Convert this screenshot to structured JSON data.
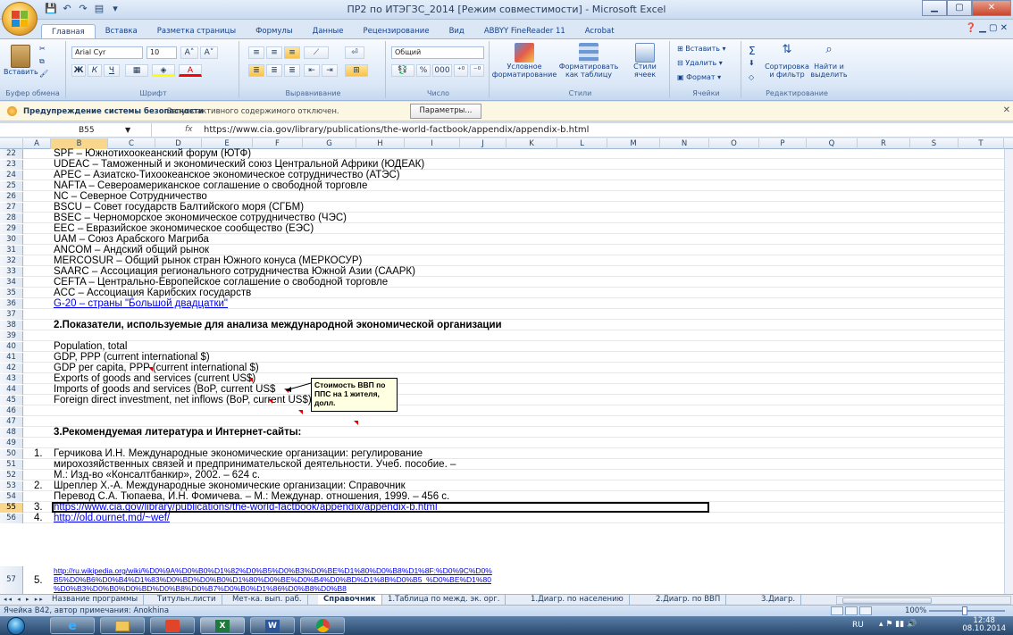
{
  "window": {
    "title": "ПР2 по ИТЭГЗС_2014  [Режим совместимости] - Microsoft Excel",
    "minimize": "▁",
    "maximize": "▢",
    "close": "✕"
  },
  "ribbon_tabs": [
    "Главная",
    "Вставка",
    "Разметка страницы",
    "Формулы",
    "Данные",
    "Рецензирование",
    "Вид",
    "ABBYY FineReader 11",
    "Acrobat"
  ],
  "ribbon": {
    "clipboard": {
      "paste": "Вставить",
      "label": "Буфер обмена"
    },
    "font": {
      "name": "Arial Cyr",
      "size": "10",
      "label": "Шрифт",
      "bold": "Ж",
      "italic": "К",
      "underline": "Ч",
      "grow": "A˄",
      "shrink": "A˅"
    },
    "alignment": {
      "label": "Выравнивание"
    },
    "number": {
      "format": "Общий",
      "label": "Число",
      "percent": "%",
      "thousands": "000"
    },
    "styles": {
      "conditional": "Условное форматирование",
      "as_table": "Форматировать как таблицу",
      "cell_styles": "Стили ячеек",
      "label": "Стили"
    },
    "cells": {
      "insert": "Вставить",
      "delete": "Удалить",
      "format": "Формат",
      "label": "Ячейки"
    },
    "editing": {
      "sum": "Σ",
      "sort": "Сортировка и фильтр",
      "find": "Найти и выделить",
      "label": "Редактирование"
    }
  },
  "security_bar": {
    "title": "Предупреждение системы безопасности",
    "message": "Запуск активного содержимого отключен.",
    "button": "Параметры..."
  },
  "formula_bar": {
    "name_box": "B55",
    "fx": "fx",
    "content": "https://www.cia.gov/library/publications/the-world-factbook/appendix/appendix-b.html"
  },
  "columns": [
    "A",
    "B",
    "C",
    "D",
    "E",
    "F",
    "G",
    "H",
    "I",
    "J",
    "K",
    "L",
    "M",
    "N",
    "O",
    "P",
    "Q",
    "R",
    "S",
    "T"
  ],
  "rows": [
    {
      "n": "22",
      "a": "",
      "b": "SPF – Южнотихоокеанский форум (ЮТФ)"
    },
    {
      "n": "23",
      "a": "",
      "b": "UDEAC – Таможенный и экономический союз Центральной Африки (ЮДЕАК)"
    },
    {
      "n": "24",
      "a": "",
      "b": "APEC – Азиатско-Тихоокеанское экономическое сотрудничество (АТЭС)"
    },
    {
      "n": "25",
      "a": "",
      "b": "NAFTA – Североамериканское соглашение о свободной торговле"
    },
    {
      "n": "26",
      "a": "",
      "b": "NC – Северное Сотрудничество"
    },
    {
      "n": "27",
      "a": "",
      "b": "BSCU – Совет государств Балтийского моря (СГБМ)"
    },
    {
      "n": "28",
      "a": "",
      "b": "BSEC – Черноморское экономическое сотрудничество (ЧЭС)"
    },
    {
      "n": "29",
      "a": "",
      "b": "EEC – Евразийское экономическое сообщество (ЕЭС)"
    },
    {
      "n": "30",
      "a": "",
      "b": "UAM – Союз Арабского Магриба"
    },
    {
      "n": "31",
      "a": "",
      "b": "ANCOM – Андский общий рынок"
    },
    {
      "n": "32",
      "a": "",
      "b": "MERCOSUR – Общий рынок стран Южного конуса (МЕРКОСУР)"
    },
    {
      "n": "33",
      "a": "",
      "b": "SAARC – Ассоциация регионального сотрудничества Южной Азии (СААРК)"
    },
    {
      "n": "34",
      "a": "",
      "b": "CEFTA – Центрально-Европейское соглашение о свободной торговле"
    },
    {
      "n": "35",
      "a": "",
      "b": "ACC – Ассоциация Карибских государств"
    },
    {
      "n": "36",
      "a": "",
      "b": "G-20 – страны \"Большой двадцатки\"",
      "link": true
    },
    {
      "n": "37",
      "a": "",
      "b": ""
    },
    {
      "n": "38",
      "a": "",
      "b": "2.Показатели, используемые для анализа международной экономической организации",
      "bold": true
    },
    {
      "n": "39",
      "a": "",
      "b": ""
    },
    {
      "n": "40",
      "a": "",
      "b": "Population, total"
    },
    {
      "n": "41",
      "a": "",
      "b": "GDP, PPP (current international $)"
    },
    {
      "n": "42",
      "a": "",
      "b": "GDP per capita, PPP (current international $)"
    },
    {
      "n": "43",
      "a": "",
      "b": "Exports of goods and services (current US$)"
    },
    {
      "n": "44",
      "a": "",
      "b": "Imports of goods and services (BoP, current US$"
    },
    {
      "n": "45",
      "a": "",
      "b": "Foreign direct investment, net inflows (BoP, current US$)"
    },
    {
      "n": "46",
      "a": "",
      "b": ""
    },
    {
      "n": "47",
      "a": "",
      "b": ""
    },
    {
      "n": "48",
      "a": "",
      "b": "3.Рекомендуемая литература и Интернет-сайты:",
      "bold": true
    },
    {
      "n": "49",
      "a": "",
      "b": ""
    },
    {
      "n": "50",
      "a": "1.",
      "b": "Герчикова И.Н. Международные экономические организации: регулирование"
    },
    {
      "n": "51",
      "a": "",
      "b": "мирохозяйственных связей и предпринимательской деятельности. Учеб. пособие. –"
    },
    {
      "n": "52",
      "a": "",
      "b": "М.: Изд-во «Консалтбанкир», 2002. – 624 с."
    },
    {
      "n": "53",
      "a": "2.",
      "b": " Шреплер Х.-А. Международные экономические организации: Справочник"
    },
    {
      "n": "54",
      "a": "",
      "b": "Перевод С.А. Тюпаева, И.Н. Фомичева. – М.: Междунар. отношения, 1999. – 456 с."
    },
    {
      "n": "55",
      "a": "3.",
      "b": "https://www.cia.gov/library/publications/the-world-factbook/appendix/appendix-b.html",
      "link": true,
      "selected": true
    },
    {
      "n": "56",
      "a": "4.",
      "b": "http://old.ournet.md/~wef/",
      "link": true
    }
  ],
  "row57": {
    "n": "57",
    "a": "5.",
    "lines": [
      "http://ru.wikipedia.org/wiki/%D0%9A%D0%B0%D1%82%D0%B5%D0%B3%D0%BE%D1%80%D0%B8%D1%8F:%D0%9C%D0%",
      "B5%D0%B6%D0%B4%D1%83%D0%BD%D0%B0%D1%80%D0%BE%D0%B4%D0%BD%D1%8B%D0%B5_%D0%BE%D1%80",
      "%D0%B3%D0%B0%D0%BD%D0%B8%D0%B7%D0%B0%D1%86%D0%B8%D0%B8"
    ]
  },
  "comment": {
    "text": "Стоимость ВВП по ППС на 1 жителя, долл."
  },
  "sheet_tabs": [
    "Название программы",
    "Титульн.листи",
    "Мет-ка. вып. раб.",
    "Справочник",
    "1.Таблица по межд. эк. орг.",
    "1.Диагр. по населению",
    "2.Диагр. по ВВП",
    "3.Диагр."
  ],
  "active_sheet": "Справочник",
  "status": {
    "message": "Ячейка B42, автор примечания: Anokhina",
    "zoom": "100%"
  },
  "taskbar": {
    "lang": "RU",
    "time": "12:48",
    "date": "08.10.2014"
  }
}
